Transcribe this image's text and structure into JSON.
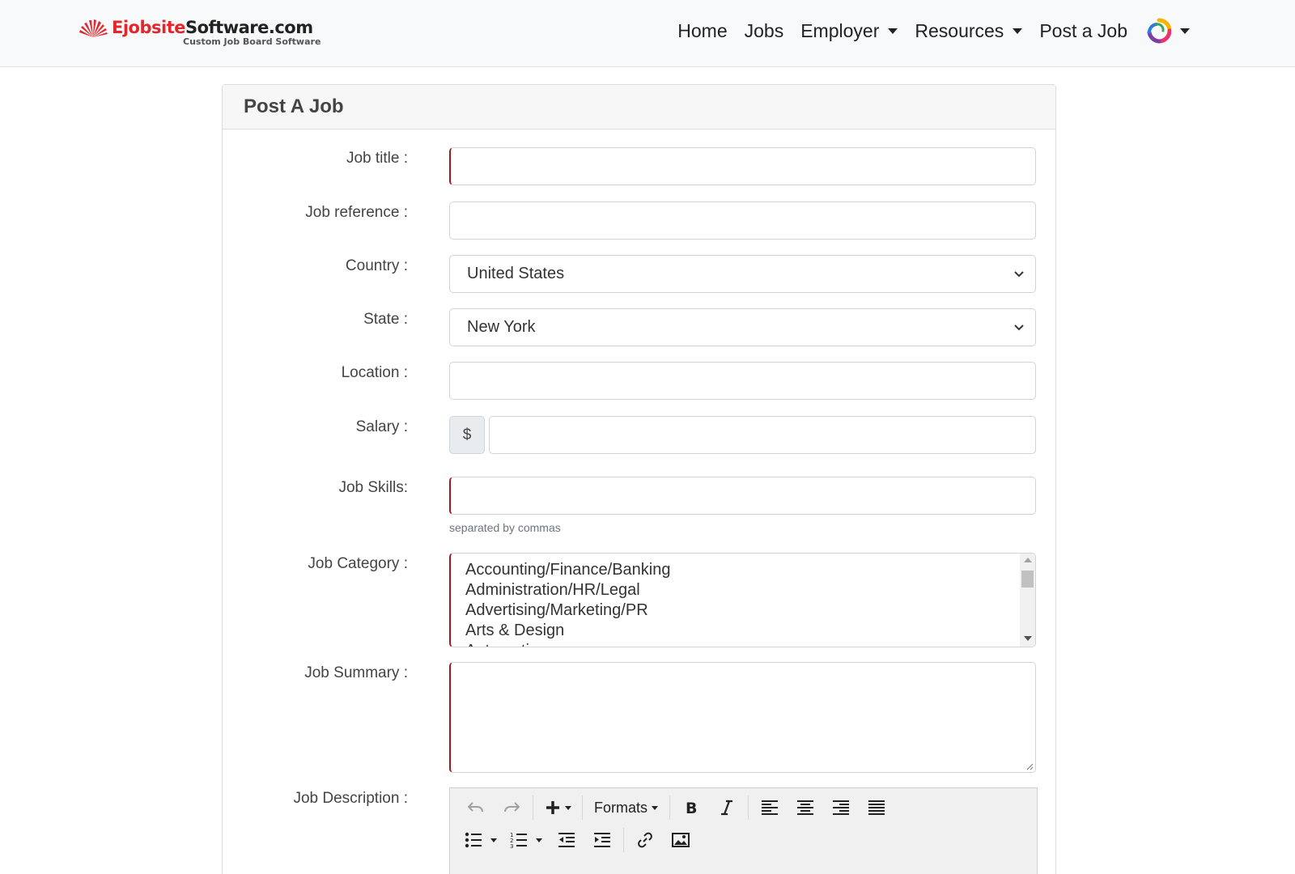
{
  "brand": {
    "name_part1": "Ejobsite",
    "name_part2": "Software.com",
    "tagline": "Custom Job Board Software",
    "color_red": "#e3262b"
  },
  "nav": {
    "items": [
      {
        "label": "Home",
        "dropdown": false
      },
      {
        "label": "Jobs",
        "dropdown": false
      },
      {
        "label": "Employer",
        "dropdown": true
      },
      {
        "label": "Resources",
        "dropdown": true
      },
      {
        "label": "Post a Job",
        "dropdown": false
      }
    ],
    "avatar_icon": "user-avatar-icon"
  },
  "form": {
    "title": "Post A Job",
    "job_title": {
      "label": "Job title :",
      "value": ""
    },
    "job_reference": {
      "label": "Job reference :",
      "value": ""
    },
    "country": {
      "label": "Country :",
      "selected": "United States"
    },
    "state": {
      "label": "State :",
      "selected": "New York"
    },
    "location": {
      "label": "Location :",
      "value": ""
    },
    "salary": {
      "label": "Salary :",
      "prefix": "$",
      "value": ""
    },
    "job_skills": {
      "label": "Job Skills:",
      "value": "",
      "help": "separated by commas"
    },
    "job_category": {
      "label": "Job Category :",
      "options": [
        "Accounting/Finance/Banking",
        "Administration/HR/Legal",
        "Advertising/Marketing/PR",
        "Arts & Design",
        "Automotive"
      ]
    },
    "job_summary": {
      "label": "Job Summary :",
      "value": ""
    },
    "job_description": {
      "label": "Job Description :",
      "toolbar": {
        "formats_label": "Formats",
        "row1": [
          "undo-icon",
          "redo-icon",
          "insert-icon",
          "formats",
          "bold-icon",
          "italic-icon",
          "align-left-icon",
          "align-center-icon",
          "align-right-icon",
          "align-justify-icon"
        ],
        "row2": [
          "bullet-list-icon",
          "numbered-list-icon",
          "outdent-icon",
          "indent-icon",
          "link-icon",
          "image-icon"
        ]
      }
    },
    "required_border_color": "#a01820"
  }
}
